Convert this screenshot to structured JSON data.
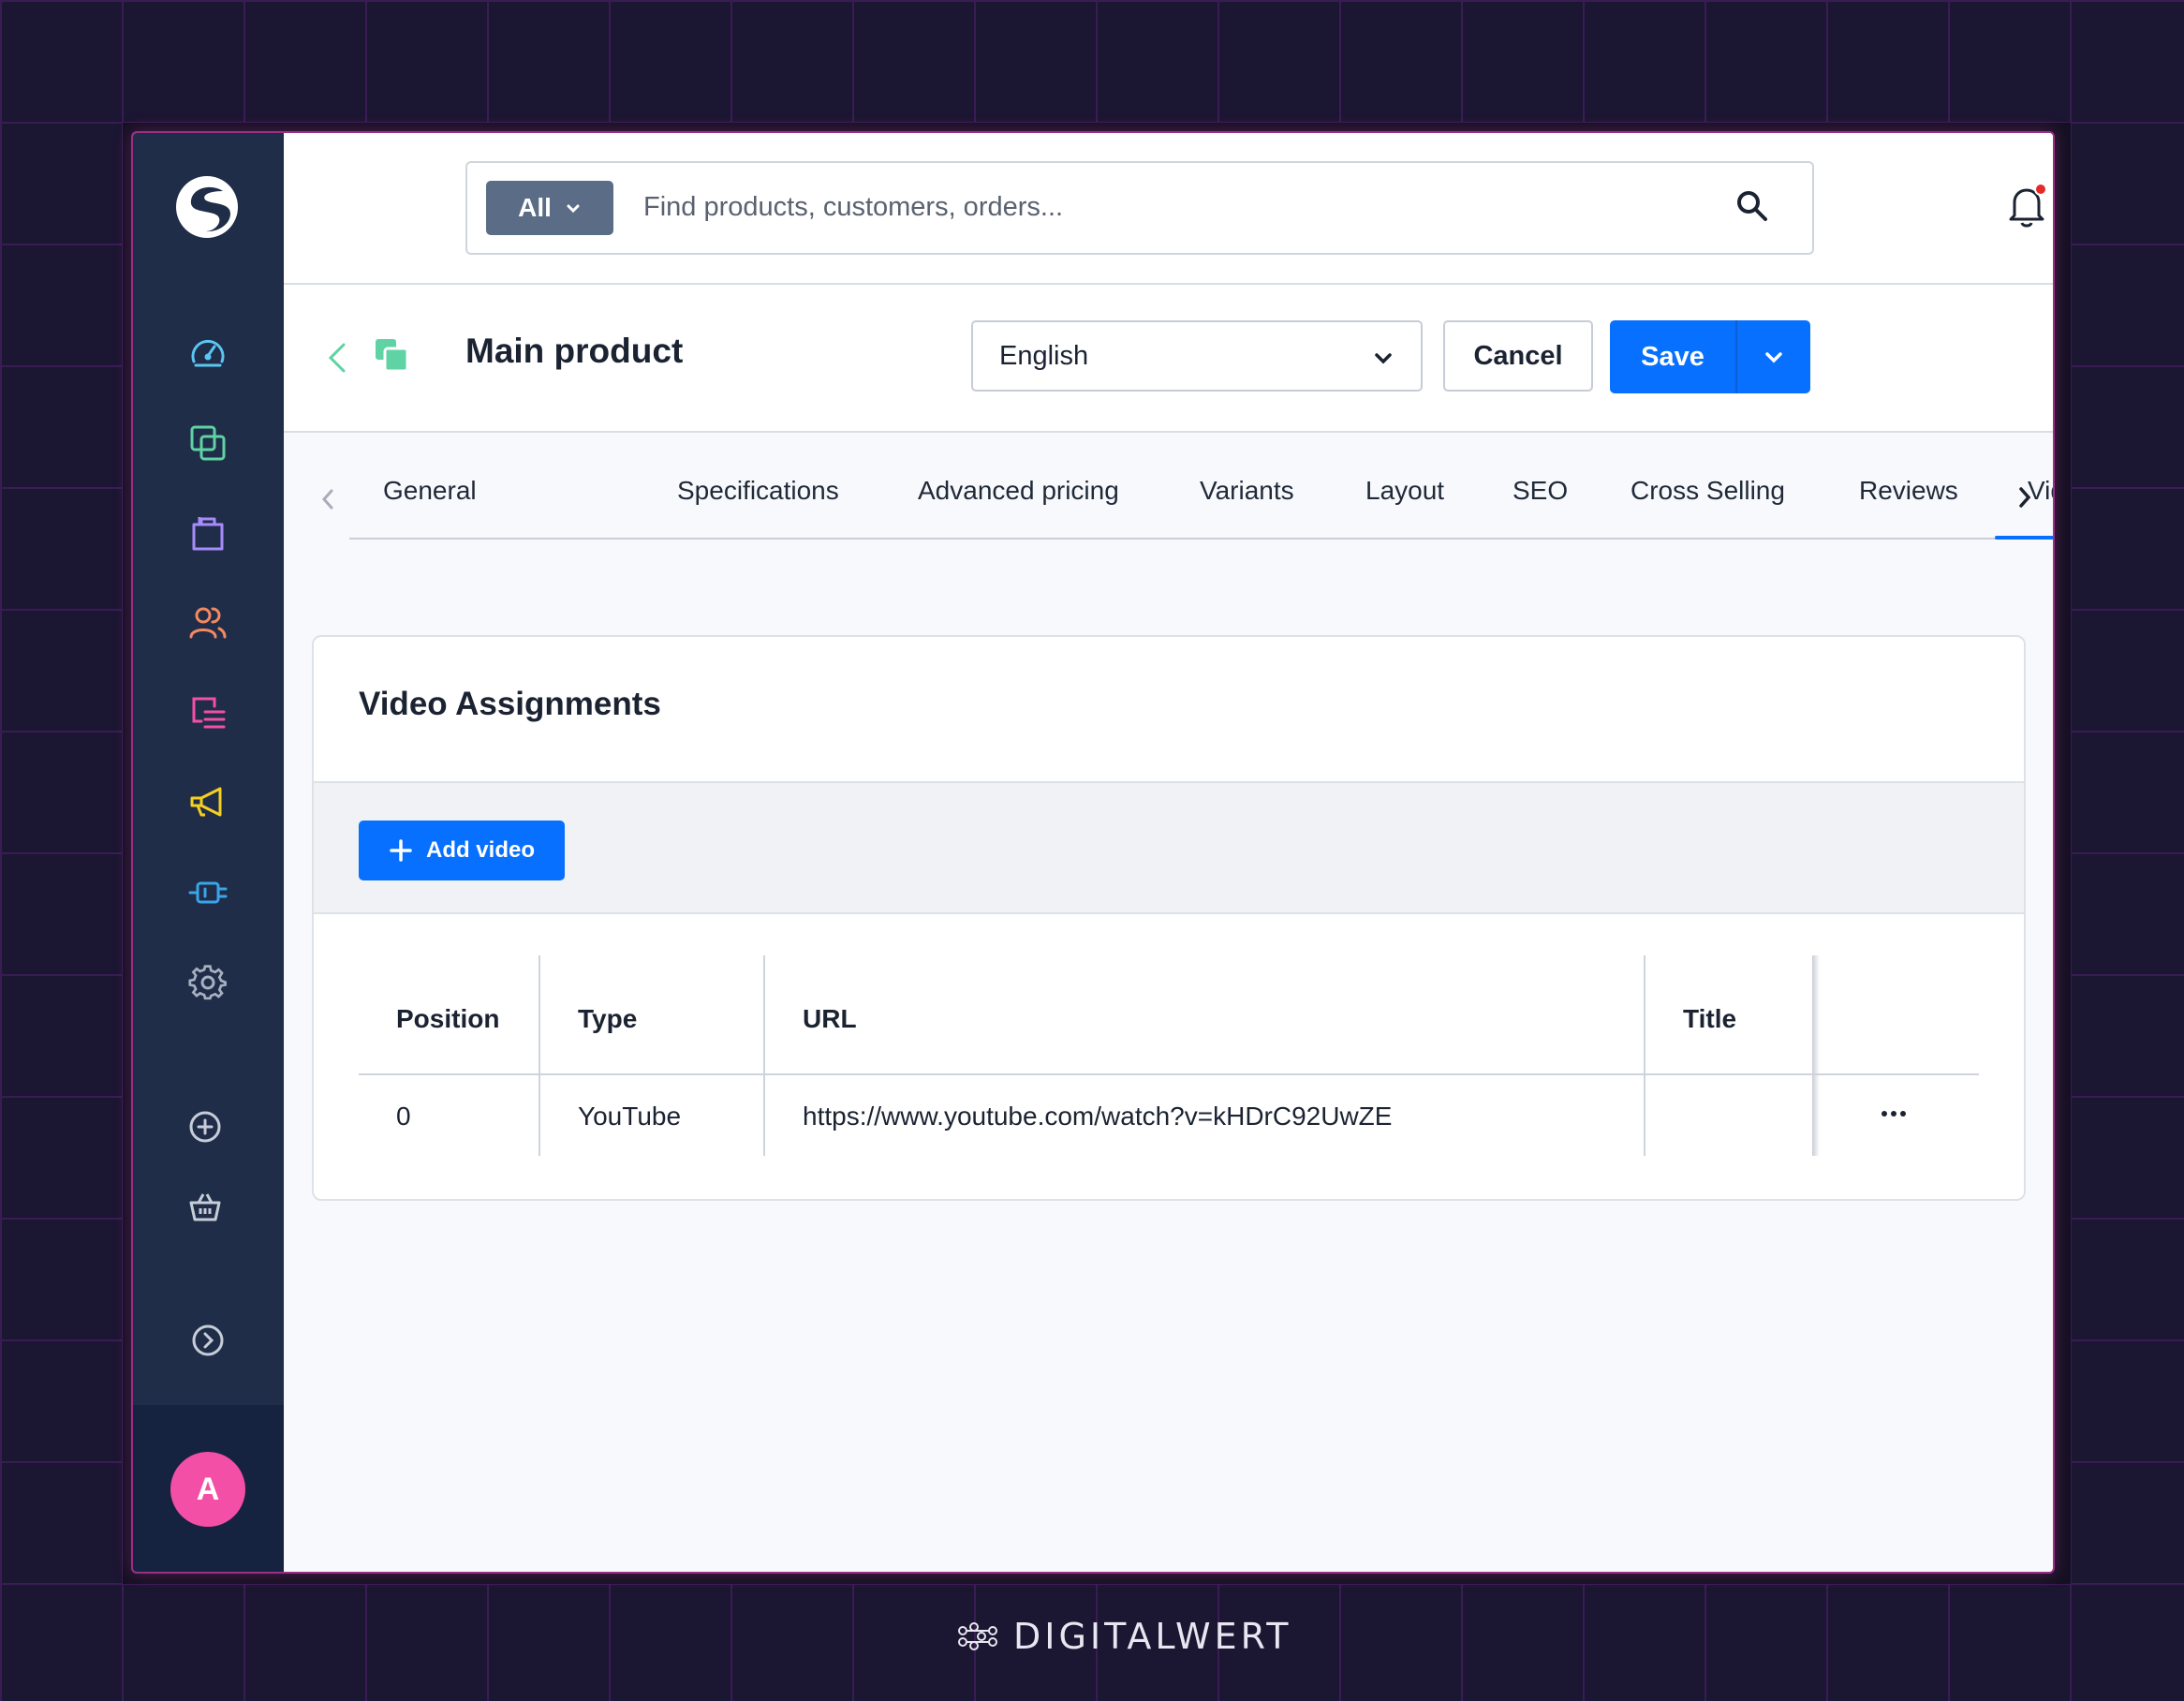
{
  "search": {
    "filter_label": "All",
    "placeholder": "Find products, customers, orders..."
  },
  "header": {
    "title": "Main product",
    "language": "English",
    "cancel_label": "Cancel",
    "save_label": "Save"
  },
  "tabs": [
    {
      "label": "General"
    },
    {
      "label": "Specifications"
    },
    {
      "label": "Advanced pricing"
    },
    {
      "label": "Variants"
    },
    {
      "label": "Layout"
    },
    {
      "label": "SEO"
    },
    {
      "label": "Cross Selling"
    },
    {
      "label": "Reviews"
    },
    {
      "label": "Videos"
    }
  ],
  "active_tab": "Videos",
  "card": {
    "title": "Video Assignments",
    "add_label": "Add video"
  },
  "table": {
    "columns": [
      "Position",
      "Type",
      "URL",
      "Title"
    ],
    "rows": [
      {
        "position": "0",
        "type": "YouTube",
        "url": "https://www.youtube.com/watch?v=kHDrC92UwZE",
        "title": ""
      }
    ]
  },
  "user": {
    "avatar_initial": "A"
  },
  "brand": {
    "name": "DIGITALWERT"
  },
  "colors": {
    "primary": "#0870ff",
    "sidebar": "#1f2d49",
    "avatar": "#f44fa6",
    "notification_dot": "#e52a2a"
  },
  "sidebar_icons": [
    "dashboard-icon",
    "catalogue-icon",
    "orders-icon",
    "customers-icon",
    "content-icon",
    "marketing-icon",
    "extensions-icon",
    "settings-icon",
    "add-icon",
    "sales-channel-icon",
    "expand-icon"
  ]
}
